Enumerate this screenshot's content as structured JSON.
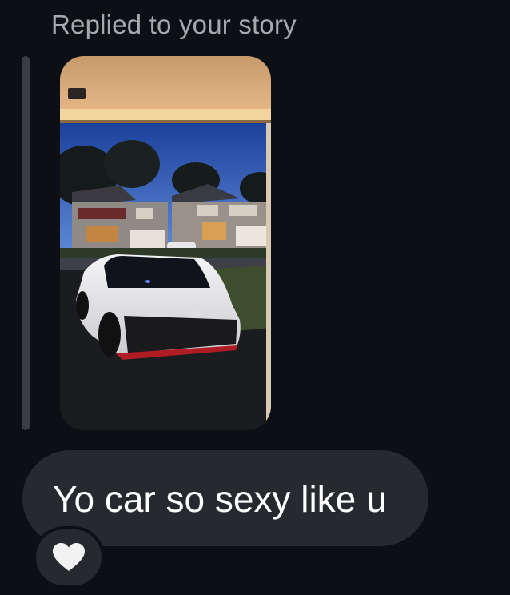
{
  "story_reply": {
    "header_text": "Replied to your story",
    "thumbnail_icon": "story-photo"
  },
  "message": {
    "text": "Yo car so sexy like u"
  },
  "reaction": {
    "icon": "white-heart-icon",
    "color": "#f2f2f2"
  },
  "colors": {
    "background": "#0c1014",
    "bubble": "#262a2f",
    "header_text": "#a8a8ad",
    "message_text": "#ffffff",
    "reply_bar": "#3a3d42"
  }
}
